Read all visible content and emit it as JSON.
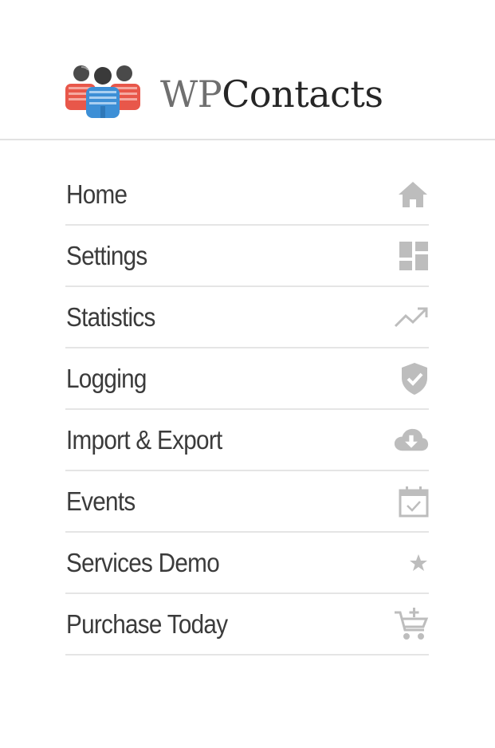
{
  "brand": {
    "prefix": "WP",
    "name": "Contacts",
    "logo_icon": "people-group-icon"
  },
  "menu": {
    "items": [
      {
        "label": "Home",
        "icon": "home-icon"
      },
      {
        "label": "Settings",
        "icon": "dashboard-icon"
      },
      {
        "label": "Statistics",
        "icon": "trending-up-icon"
      },
      {
        "label": "Logging",
        "icon": "shield-check-icon"
      },
      {
        "label": "Import & Export",
        "icon": "cloud-download-icon"
      },
      {
        "label": "Events",
        "icon": "calendar-check-icon"
      },
      {
        "label": "Services Demo",
        "icon": "star-icon"
      },
      {
        "label": "Purchase Today",
        "icon": "cart-add-icon"
      }
    ]
  },
  "colors": {
    "icon_gray": "#bdbdbd",
    "text": "#3b3b3b",
    "divider": "#e5e5e5",
    "logo_red": "#e8574a",
    "logo_blue": "#3d8fd6",
    "logo_dark": "#4a4a4a"
  }
}
